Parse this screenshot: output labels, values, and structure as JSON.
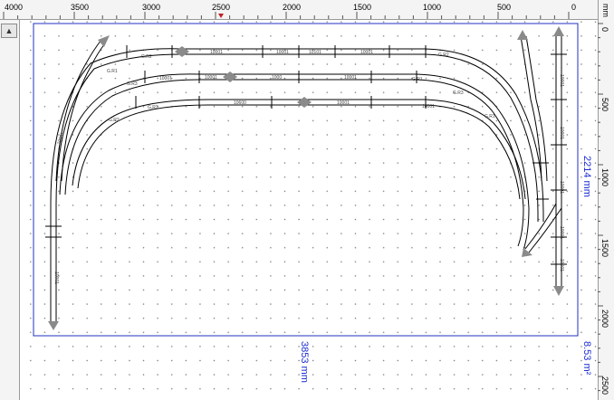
{
  "ruler": {
    "unit": "mm",
    "top_labels": [
      "4000",
      "3500",
      "3000",
      "2500",
      "2000",
      "1500",
      "1000",
      "500",
      "0"
    ],
    "right_labels": [
      "0",
      "500",
      "1000",
      "1500",
      "2000",
      "2500"
    ]
  },
  "toolbar": {
    "collapse_glyph": "▲"
  },
  "dimensions": {
    "width": "3853 mm",
    "height": "2214 mm",
    "area": "8.53 m²"
  },
  "track_labels": {
    "straight": [
      "10001",
      "10001",
      "10101",
      "10001",
      "10001",
      "1000",
      "10001",
      "10600",
      "10001",
      "10001",
      "10001"
    ],
    "curve": [
      "G.R2",
      "G.R2",
      "G.R1",
      "G.R1",
      "G.R3",
      "G.R3",
      "G.R2",
      "G.R1",
      "G.R3"
    ],
    "vertical": [
      "10001",
      "10001",
      "10001",
      "10001",
      "10001",
      "10001",
      "10001"
    ]
  },
  "colors": {
    "dimension": "#1a2bd6",
    "track": "#000000",
    "endpoint": "#8a8a8a"
  }
}
